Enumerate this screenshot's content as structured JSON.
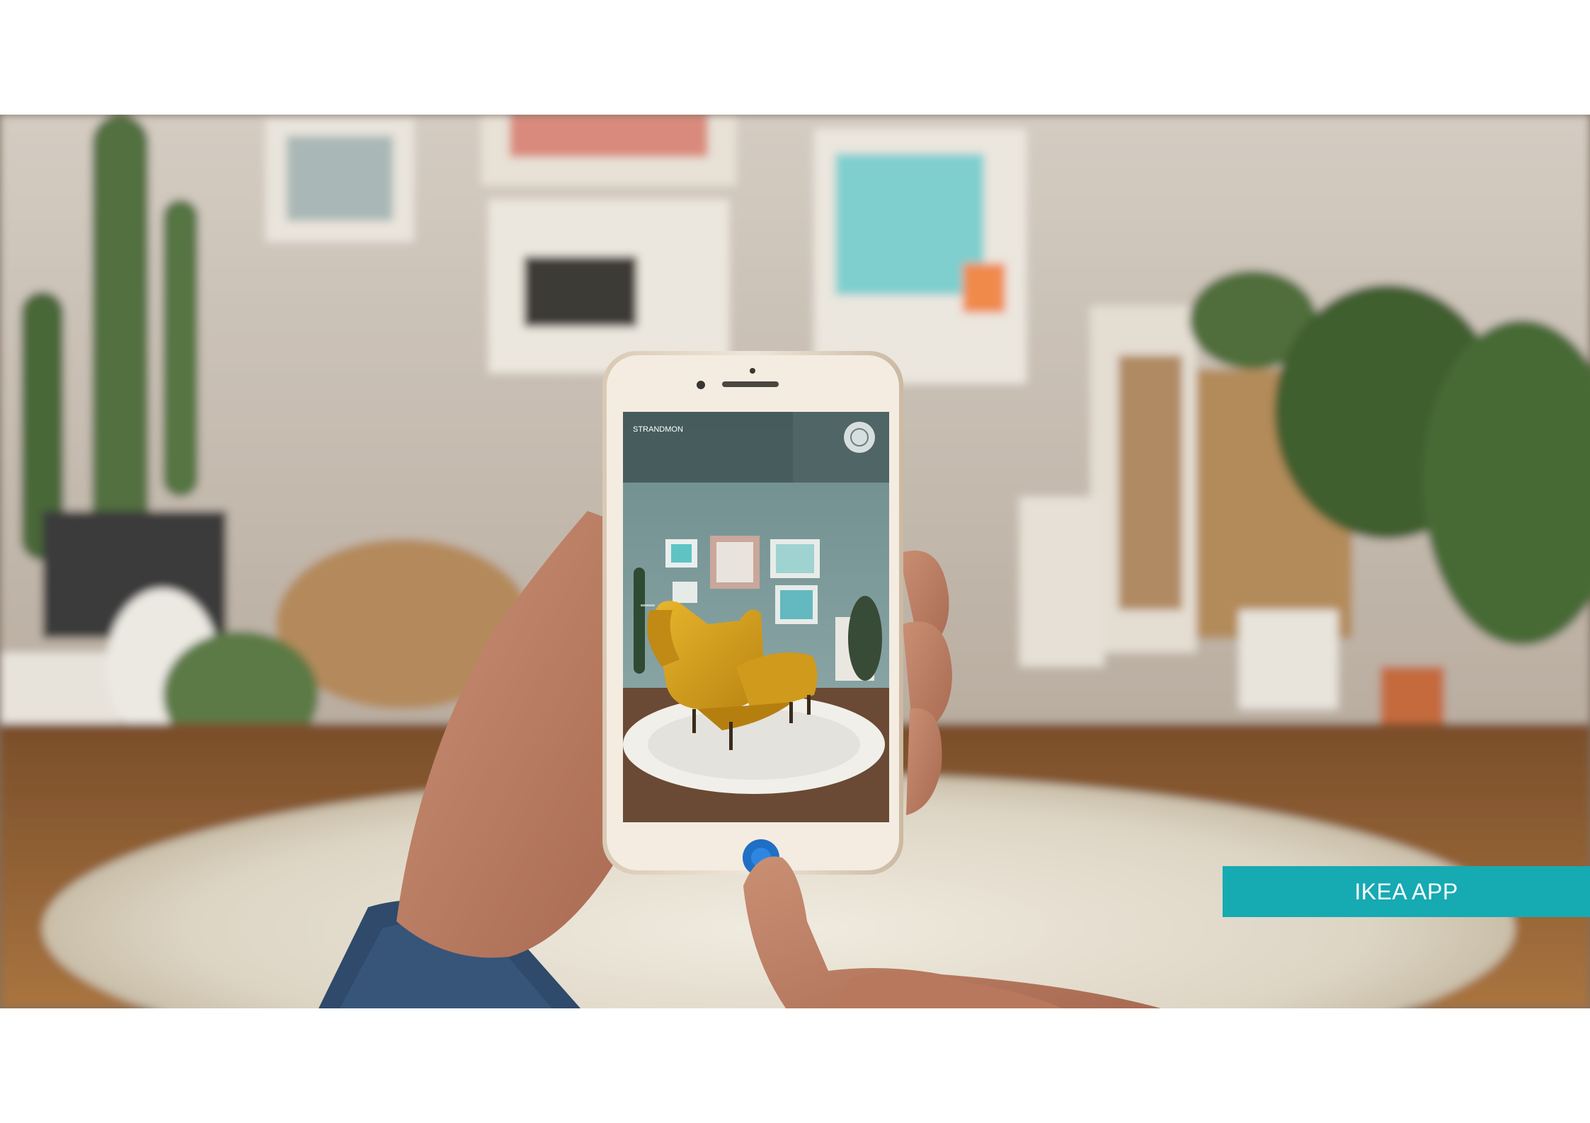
{
  "caption": {
    "label": "IKEA APP",
    "background_color": "#16aab3",
    "text_color": "#ffffff"
  },
  "photo": {
    "screen_ui": {
      "product_name": "STRANDMON",
      "product_price": "",
      "menu_icon": "circle-menu-icon",
      "place_button_icon": "place-button-icon",
      "place_button_color": "#1f6fc4"
    },
    "accent_colors": {
      "armchair": "#d9a21c",
      "wall": "#cfc7bd",
      "floor": "#8a5a32",
      "rug": "#e7e2d6"
    }
  }
}
